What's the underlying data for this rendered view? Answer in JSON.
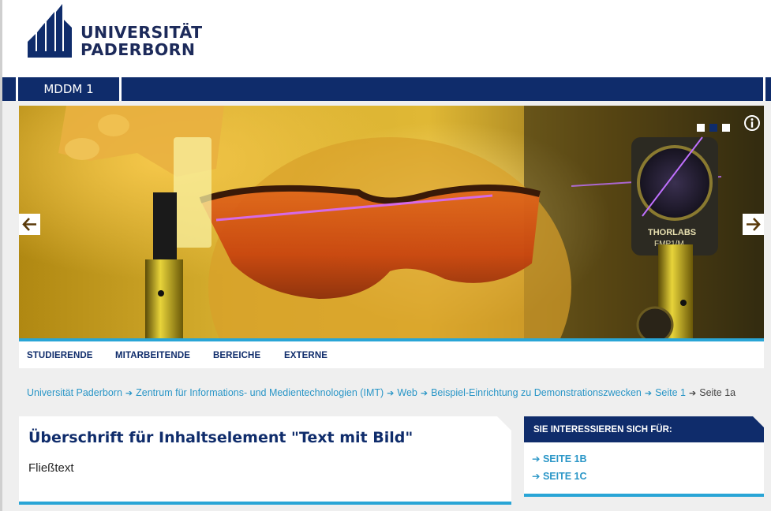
{
  "brand": {
    "name_line1": "UNIVERSITÄT",
    "name_line2": "PADERBORN",
    "color": "#0f2c6b"
  },
  "site": {
    "tab_label": "MDDM 1"
  },
  "slider": {
    "slides_total": 3,
    "active_slide": 2,
    "info_icon": "info-icon",
    "prev_icon": "arrow-left-icon",
    "next_icon": "arrow-right-icon",
    "lens_label_1": "THORLABS",
    "lens_label_2": "FMP1/M"
  },
  "mainnav": {
    "items": [
      "STUDIERENDE",
      "MITARBEITENDE",
      "BEREICHE",
      "EXTERNE"
    ]
  },
  "breadcrumb": {
    "items": [
      "Universität Paderborn",
      "Zentrum für Informations- und Medientechnologien (IMT)",
      "Web",
      "Beispiel-Einrichtung zu Demonstrationszwecken",
      "Seite 1"
    ],
    "current": "Seite 1a",
    "separator": "➔"
  },
  "content": {
    "heading": "Überschrift für Inhaltselement \"Text mit Bild\"",
    "body": "Fließtext"
  },
  "sidebar": {
    "title": "SIE INTERESSIEREN SICH FÜR:",
    "links": [
      "➔ SEITE 1B",
      "➔ SEITE 1C"
    ]
  },
  "colors": {
    "navy": "#0f2c6b",
    "accent_blue": "#29a5d6",
    "link_blue": "#2a96c7",
    "background": "#efefef"
  }
}
